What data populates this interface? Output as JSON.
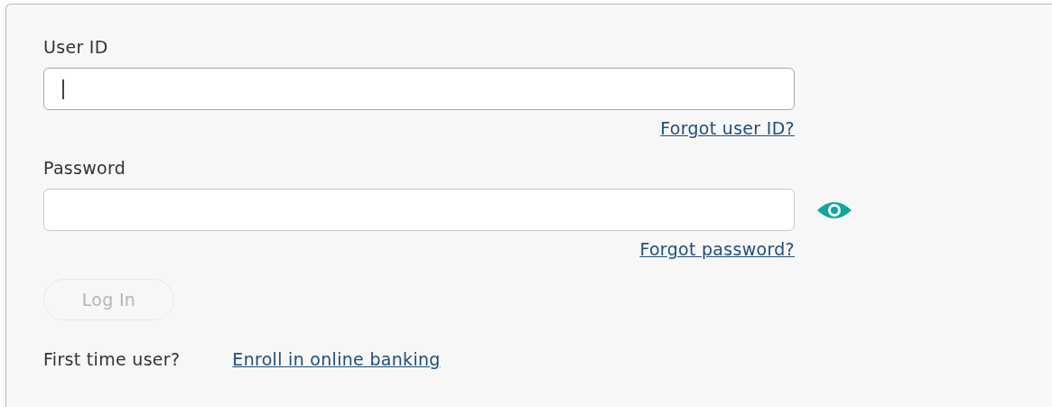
{
  "form": {
    "fields": [
      {
        "label": "User ID",
        "focused": true,
        "link": "Forgot user ID?",
        "reveal_toggle": false
      },
      {
        "label": "Password",
        "focused": false,
        "link": "Forgot password?",
        "reveal_toggle": true
      }
    ],
    "login_button": {
      "label": "Log In",
      "disabled": true
    },
    "enroll": {
      "prompt": "First time user?",
      "link": "Enroll in online banking"
    }
  }
}
